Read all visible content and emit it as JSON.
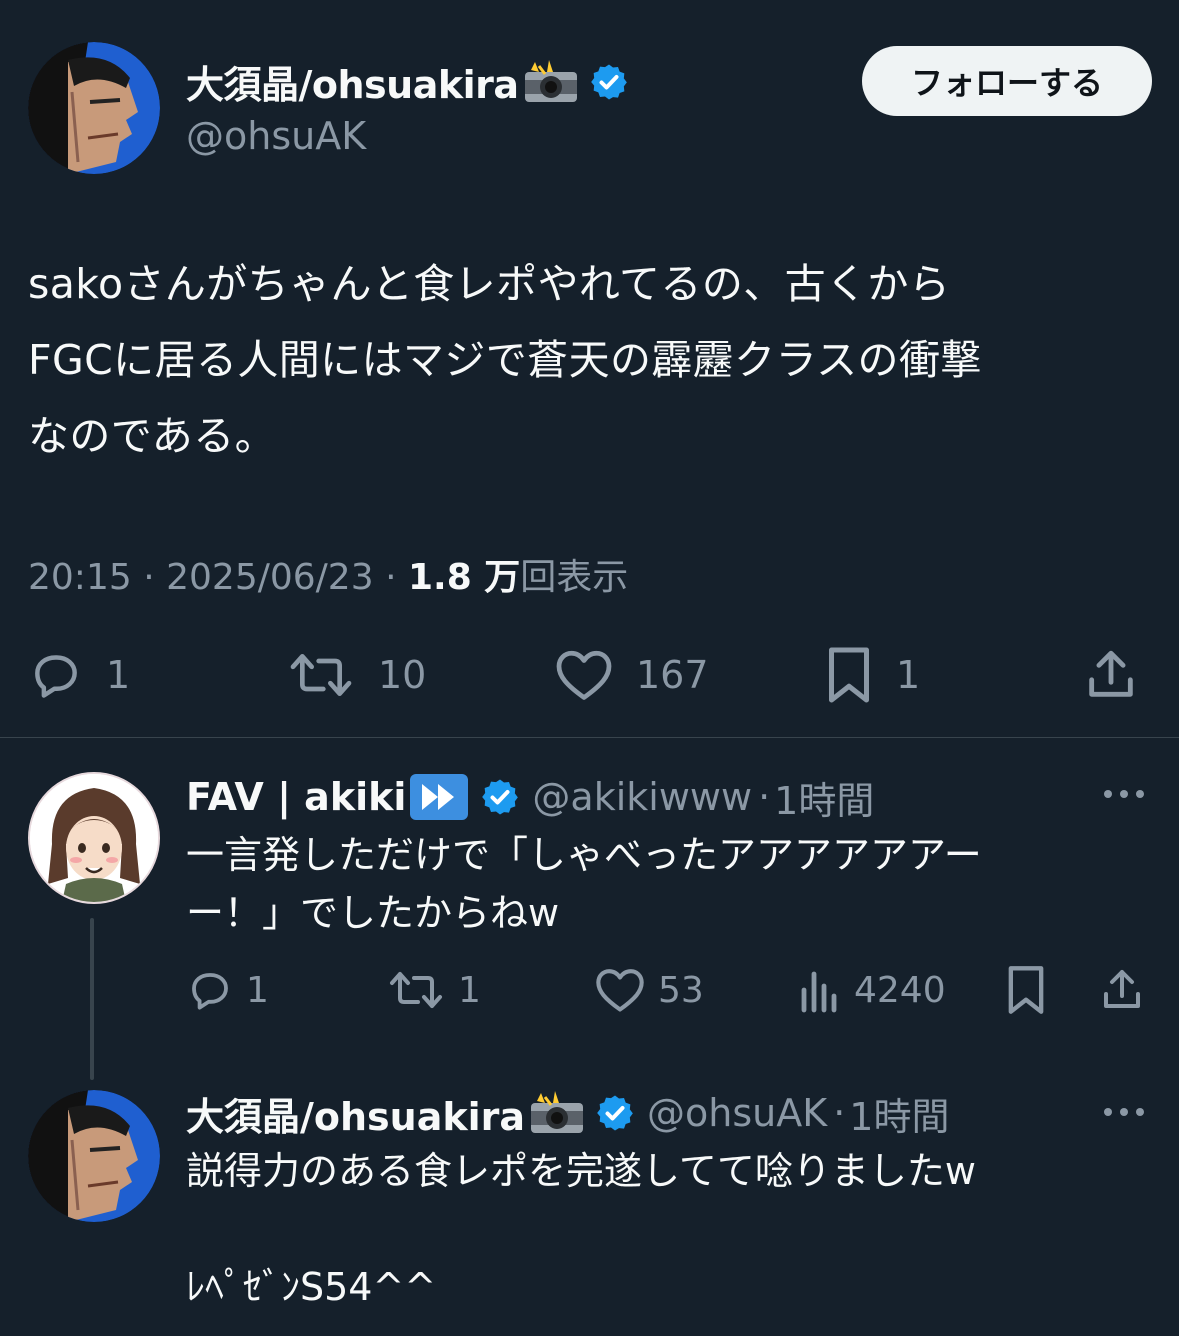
{
  "main_tweet": {
    "display_name": "大須晶/ohsuakira",
    "handle": "@ohsuAK",
    "follow_label": "フォローする",
    "text_lines": [
      "sakoさんがちゃんと食レポやれてるの、古くから",
      "FGCに居る人間にはマジで蒼天の霹靂クラスの衝撃",
      "なのである。"
    ],
    "time": "20:15",
    "date": "2025/06/23",
    "views_count": "1.8 万",
    "views_label": "回表示",
    "separator": "·",
    "replies": "1",
    "retweets": "10",
    "likes": "167",
    "bookmarks": "1"
  },
  "reply1": {
    "display_name": "FAV | akiki",
    "handle": "@akikiwww",
    "time": "1時間",
    "text_line1": "一言発しただけで「しゃべったアアアアアアー",
    "text_line2": "ー！」でしたからねw",
    "replies": "1",
    "retweets": "1",
    "likes": "53",
    "views": "4240"
  },
  "reply2": {
    "display_name": "大須晶/ohsuakira",
    "handle": "@ohsuAK",
    "time": "1時間",
    "text_line1": "説得力のある食レポを完遂してて唸りましたw",
    "text_line2": "ﾚﾍﾟｾﾞﾝS54^^"
  },
  "colors": {
    "background": "#15202b",
    "text": "#f7f9f9",
    "muted": "#8b98a5",
    "verified": "#1d9bf0",
    "divider": "#38444d"
  }
}
